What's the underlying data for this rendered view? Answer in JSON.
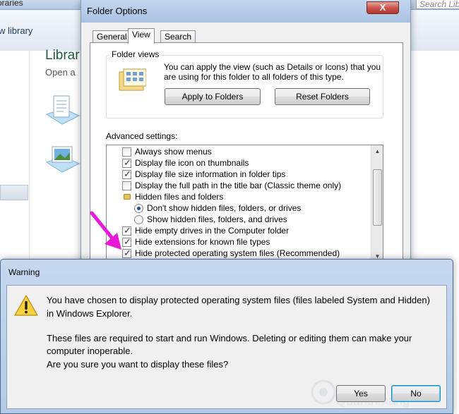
{
  "explorer": {
    "breadcrumb_tail": "oraries",
    "search_placeholder": "Search Lib",
    "new_library": "w library",
    "library_title": "Librar",
    "library_subtitle": "Open a"
  },
  "folder_options": {
    "title": "Folder Options",
    "close": "X",
    "tabs": [
      "General",
      "View",
      "Search"
    ],
    "active_tab": "View",
    "folder_views": {
      "label": "Folder views",
      "description_line1": "You can apply the view (such as Details or Icons) that you",
      "description_line2": "are using for this folder to all folders of this type.",
      "apply_button": "Apply to Folders",
      "reset_button": "Reset Folders"
    },
    "advanced_label": "Advanced settings:",
    "advanced_items": [
      {
        "kind": "checkbox",
        "checked": false,
        "label": "Always show menus"
      },
      {
        "kind": "checkbox",
        "checked": true,
        "label": "Display file icon on thumbnails"
      },
      {
        "kind": "checkbox",
        "checked": true,
        "label": "Display file size information in folder tips"
      },
      {
        "kind": "checkbox",
        "checked": false,
        "label": "Display the full path in the title bar (Classic theme only)"
      },
      {
        "kind": "folder",
        "label": "Hidden files and folders"
      },
      {
        "kind": "radio",
        "checked": true,
        "label": "Don't show hidden files, folders, or drives"
      },
      {
        "kind": "radio",
        "checked": false,
        "label": "Show hidden files, folders, and drives"
      },
      {
        "kind": "checkbox",
        "checked": true,
        "label": "Hide empty drives in the Computer folder"
      },
      {
        "kind": "checkbox",
        "checked": true,
        "label": "Hide extensions for known file types"
      },
      {
        "kind": "checkbox",
        "checked": true,
        "label": "Hide protected operating system files (Recommended)"
      }
    ]
  },
  "warning": {
    "title": "Warning",
    "line1": "You have chosen to display protected operating system files (files labeled System and Hidden)",
    "line2": "in Windows Explorer.",
    "line3": "These files are required to start and run Windows. Deleting or editing them can make your",
    "line4": "computer inoperable.",
    "line5": "Are you sure you want to display these files?",
    "yes_button": "Yes",
    "no_button": "No"
  },
  "watermark": "Quantrimang",
  "colors": {
    "accent_arrow": "#e619d6",
    "titlebar": "#b9cde6",
    "dialog_bg": "#f0f0f0"
  }
}
